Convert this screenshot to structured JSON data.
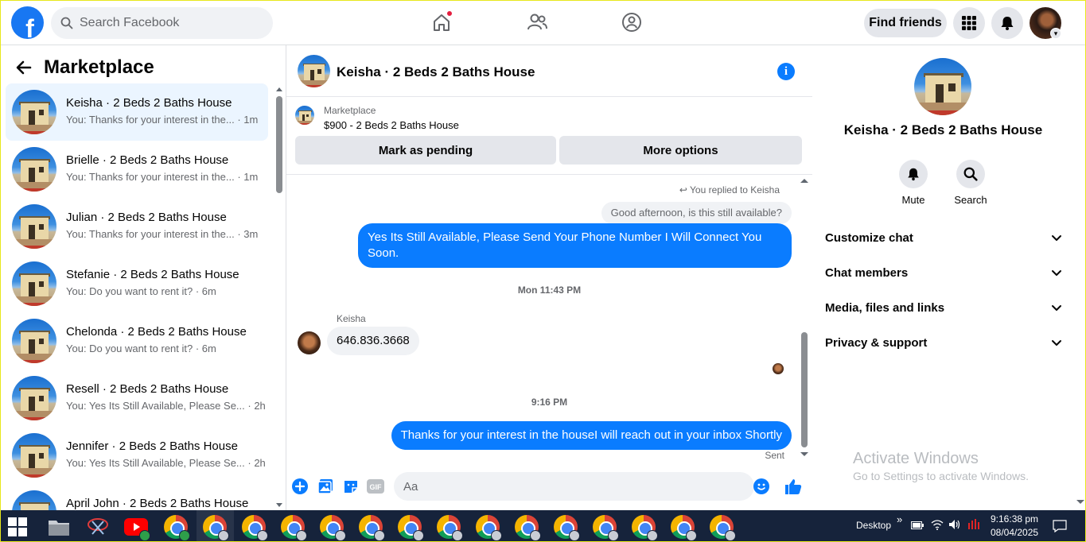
{
  "topbar": {
    "logo": "f",
    "search_placeholder": "Search Facebook",
    "find_friends": "Find friends",
    "icons": [
      "home-icon",
      "friends-icon",
      "groups-icon",
      "menu-grid-icon",
      "notifications-icon"
    ]
  },
  "sidebar": {
    "title": "Marketplace",
    "conversations": [
      {
        "name": "Keisha · 2 Beds 2 Baths House",
        "preview": "You: Thanks for your interest in the... · 1m",
        "active": true
      },
      {
        "name": "Brielle · 2 Beds 2 Baths House",
        "preview": "You: Thanks for your interest in the... · 1m"
      },
      {
        "name": "Julian · 2 Beds 2 Baths House",
        "preview": "You: Thanks for your interest in the... · 3m"
      },
      {
        "name": "Stefanie · 2 Beds 2 Baths House",
        "preview": "You: Do you want to rent it? · 6m"
      },
      {
        "name": "Chelonda · 2 Beds 2 Baths House",
        "preview": "You: Do you want to rent it? · 6m"
      },
      {
        "name": "Resell · 2 Beds 2 Baths House",
        "preview": "You: Yes Its Still Available, Please Se... · 2h"
      },
      {
        "name": "Jennifer · 2 Beds 2 Baths House",
        "preview": "You: Yes Its Still Available, Please Se... · 2h"
      },
      {
        "name": "April John · 2 Beds 2 Baths House",
        "preview": ""
      }
    ]
  },
  "chat": {
    "title": "Keisha · 2 Beds 2 Baths House",
    "listing": {
      "category": "Marketplace",
      "price_title": "$900 - 2 Beds 2 Baths House",
      "mark_pending": "Mark as pending",
      "more_options": "More options"
    },
    "messages": {
      "replied_note": "You replied to Keisha",
      "quoted": "Good afternoon, is this still available?",
      "reply": "Yes Its Still Available, Please Send Your Phone Number I Will Connect You Soon.",
      "time1": "Mon 11:43 PM",
      "sender": "Keisha",
      "incoming": "646.836.3668",
      "time2": "9:16 PM",
      "last": "Thanks for your interest in the houseI will reach out in your inbox Shortly",
      "status": "Sent"
    },
    "composer_placeholder": "Aa"
  },
  "details": {
    "name": "Keisha · 2 Beds 2 Baths House",
    "actions": {
      "mute": "Mute",
      "search": "Search"
    },
    "sections": [
      "Customize chat",
      "Chat members",
      "Media, files and links",
      "Privacy & support"
    ]
  },
  "watermark": {
    "title": "Activate Windows",
    "subtitle": "Go to Settings to activate Windows."
  },
  "taskbar": {
    "desktop": "Desktop",
    "time": "9:16:38 pm",
    "date": "08/04/2025"
  },
  "colors": {
    "accent": "#0a7cff",
    "brand": "#1877f2",
    "active_row": "#ebf5ff"
  }
}
